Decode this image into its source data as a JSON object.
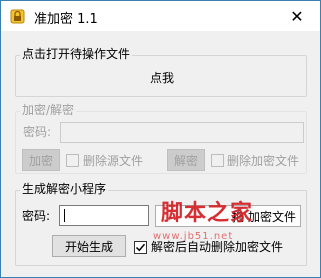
{
  "window": {
    "title": "准加密 1.1",
    "close_glyph": "✕"
  },
  "open_group": {
    "label": "点击打开待操作文件",
    "click_text": "点我"
  },
  "encrypt_group": {
    "label": "加密/解密",
    "password_label": "密码:",
    "password_value": "",
    "encrypt_button": "加密",
    "delete_source_label": "删除源文件",
    "delete_source_checked": false,
    "decrypt_button": "解密",
    "delete_encrypted_label": "删除加密文件",
    "delete_encrypted_checked": false
  },
  "generate_group": {
    "label": "生成解密小程序",
    "password_label": "密码:",
    "password_value": "",
    "drop_button_visible": "拖",
    "drop_button_visible_2": "加密文件",
    "start_button": "开始生成",
    "auto_delete_label": "解密后自动删除加密文件",
    "auto_delete_checked": true
  },
  "watermark": {
    "text": "脚本之家",
    "url": "www.jb51.net"
  }
}
